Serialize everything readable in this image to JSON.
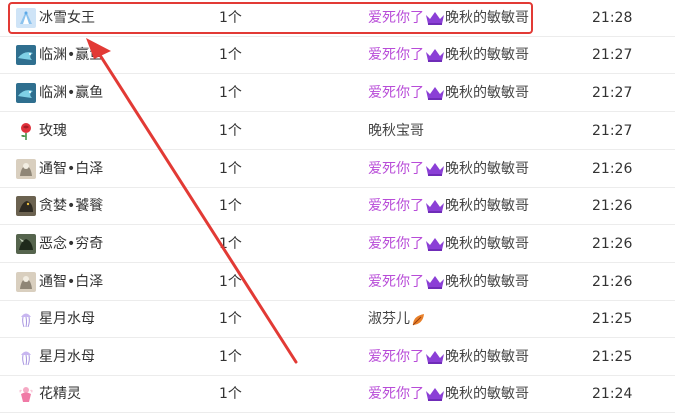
{
  "gift_records": [
    {
      "gift": "冰雪女王",
      "icon": "ice-queen-icon",
      "qty": "1个",
      "sender_vip": "爱死你了",
      "sender_name": "晚秋的敏敏哥",
      "time": "21:28"
    },
    {
      "gift": "临渊•赢鱼",
      "icon": "linyuan-yingyu-icon",
      "qty": "1个",
      "sender_vip": "爱死你了",
      "sender_name": "晚秋的敏敏哥",
      "time": "21:27"
    },
    {
      "gift": "临渊•赢鱼",
      "icon": "linyuan-yingyu-icon",
      "qty": "1个",
      "sender_vip": "爱死你了",
      "sender_name": "晚秋的敏敏哥",
      "time": "21:27"
    },
    {
      "gift": "玫瑰",
      "icon": "rose-icon",
      "qty": "1个",
      "sender_plain": "晚秋宝哥",
      "time": "21:27"
    },
    {
      "gift": "通智•白泽",
      "icon": "baize-icon",
      "qty": "1个",
      "sender_vip": "爱死你了",
      "sender_name": "晚秋的敏敏哥",
      "time": "21:26"
    },
    {
      "gift": "贪婪•饕餮",
      "icon": "taotie-icon",
      "qty": "1个",
      "sender_vip": "爱死你了",
      "sender_name": "晚秋的敏敏哥",
      "time": "21:26"
    },
    {
      "gift": "恶念•穷奇",
      "icon": "qiongqi-icon",
      "qty": "1个",
      "sender_vip": "爱死你了",
      "sender_name": "晚秋的敏敏哥",
      "time": "21:26"
    },
    {
      "gift": "通智•白泽",
      "icon": "baize-icon",
      "qty": "1个",
      "sender_vip": "爱死你了",
      "sender_name": "晚秋的敏敏哥",
      "time": "21:26"
    },
    {
      "gift": "星月水母",
      "icon": "jellyfish-icon",
      "qty": "1个",
      "sender_plain": "淑芬儿",
      "sender_badge": "leaf-icon",
      "time": "21:25"
    },
    {
      "gift": "星月水母",
      "icon": "jellyfish-icon",
      "qty": "1个",
      "sender_vip": "爱死你了",
      "sender_name": "晚秋的敏敏哥",
      "time": "21:25"
    },
    {
      "gift": "花精灵",
      "icon": "flower-fairy-icon",
      "qty": "1个",
      "sender_vip": "爱死你了",
      "sender_name": "晚秋的敏敏哥",
      "time": "21:24"
    }
  ],
  "colors": {
    "vip_text": "#b84cd8",
    "crown": "#8b3fd6",
    "highlight": "#e23a35",
    "row_border": "#ececec",
    "text": "#333333"
  }
}
